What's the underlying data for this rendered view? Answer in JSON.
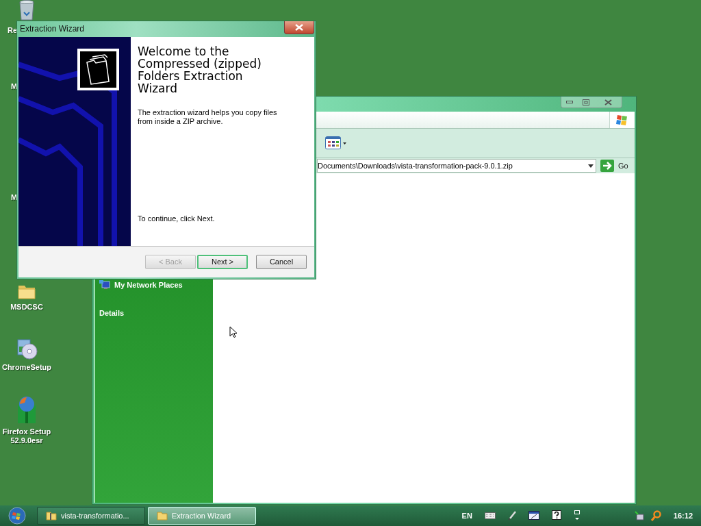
{
  "desktop_icons": [
    {
      "label": "Re",
      "kind": "recycle"
    },
    {
      "label": "M",
      "kind": "hidden"
    },
    {
      "label": "M",
      "kind": "hidden"
    },
    {
      "label": "MSDCSC",
      "kind": "folder"
    },
    {
      "label": "ChromeSetup",
      "kind": "installer"
    },
    {
      "label": "Firefox Setup 52.9.0esr",
      "kind": "globe"
    }
  ],
  "explorer": {
    "address": "Documents\\Downloads\\vista-transformation-pack-9.0.1.zip",
    "go": "Go",
    "places": [
      "My Network Places"
    ],
    "details": "Details"
  },
  "wizard": {
    "title": "Extraction Wizard",
    "heading": "Welcome to the Compressed (zipped) Folders Extraction Wizard",
    "intro": "The extraction wizard helps you copy files from inside a ZIP archive.",
    "continue": "To continue, click Next.",
    "buttons": [
      {
        "label": "< Back",
        "disabled": true,
        "default": false
      },
      {
        "label": "Next >",
        "disabled": false,
        "default": true
      },
      {
        "label": "Cancel",
        "disabled": false,
        "default": false
      }
    ]
  },
  "taskbar": {
    "tasks": [
      {
        "label": "vista-transformatio...",
        "kind": "zip",
        "selected": false
      },
      {
        "label": "Extraction Wizard",
        "kind": "folder",
        "selected": true
      }
    ],
    "language": "EN",
    "clock": "16:12"
  }
}
